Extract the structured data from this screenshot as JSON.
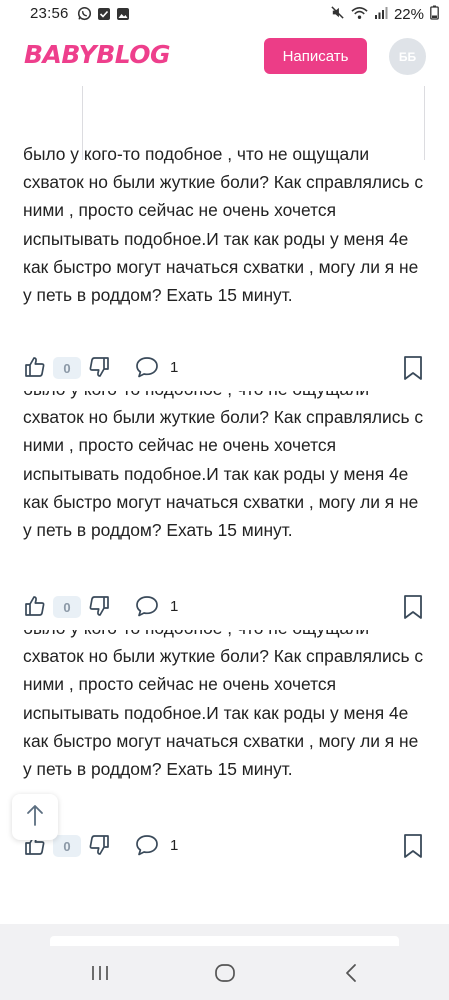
{
  "status_bar": {
    "time": "23:56",
    "battery": "22%",
    "left_icons": [
      "whatsapp-icon",
      "check-box-icon",
      "gallery-icon"
    ],
    "right_icons": [
      "mute-icon",
      "wifi-icon",
      "signal-icon"
    ]
  },
  "header": {
    "logo": "BABYBLOG",
    "write_button": "Написать",
    "avatar_initials": "ББ"
  },
  "posts": [
    {
      "top_cut_line": "было у кого-то подобное , что не ощущали",
      "text": "схваток но были жуткие боли? Как справлялись с ними , просто сейчас не очень хочется испытывать подобное.И так как роды у меня 4е как быстро могут начаться схватки , могу ли я не у петь в роддом? Ехать 15 минут.",
      "likes": "0",
      "comments": "1"
    },
    {
      "top_cut_line": "было у кого-то подобное , что не ощущали",
      "text": "схваток но были жуткие боли? Как справлялись с ними , просто сейчас не очень хочется испытывать подобное.И так как роды у меня 4е как быстро могут начаться схватки , могу ли я не у петь в роддом? Ехать 15 минут.",
      "likes": "0",
      "comments": "1"
    },
    {
      "top_cut_line": "было у кого-то подобное , что не ощущали",
      "text": "схваток но были жуткие боли? Как справлялись с ними , просто сейчас не очень хочется испытывать подобное.И так как роды у меня 4е как быстро могут начаться схватки , могу ли я не у петь в роддом? Ехать 15 минут.",
      "likes": "0",
      "comments": "1"
    }
  ],
  "colors": {
    "brand": "#ee3f8c",
    "button": "#ec3d87",
    "pill_bg": "#e9f0f6",
    "icon_gray": "#3a4a5a"
  },
  "nav_icons": [
    "recent-apps-icon",
    "home-icon",
    "back-icon"
  ],
  "scroll_top_icon": "arrow-up-icon"
}
